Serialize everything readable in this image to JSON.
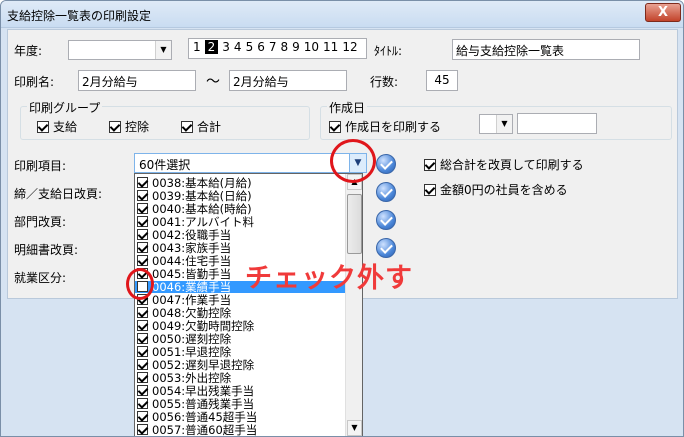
{
  "window": {
    "title": "支給控除一覧表の印刷設定",
    "close_glyph": "X"
  },
  "form": {
    "year_label": "年度:",
    "year_value": "",
    "month_numbers": [
      "1",
      "2",
      "3",
      "4",
      "5",
      "6",
      "7",
      "8",
      "9",
      "10",
      "11",
      "12"
    ],
    "month_selected": "2",
    "title_label": "ﾀｲﾄﾙ:",
    "title_value": "給与支給控除一覧表",
    "print_name_label": "印刷名:",
    "print_name_from": "2月分給与",
    "print_name_sep": "～",
    "print_name_to": "2月分給与",
    "rows_label": "行数:",
    "rows_value": "45",
    "print_group": {
      "title": "印刷グループ",
      "items": [
        {
          "label": "支給",
          "checked": true
        },
        {
          "label": "控除",
          "checked": true
        },
        {
          "label": "合計",
          "checked": true
        }
      ]
    },
    "created_date": {
      "title": "作成日",
      "print_label": "作成日を印刷する",
      "print_checked": true,
      "date_value": ""
    },
    "print_items_label": "印刷項目:",
    "print_items_value": "60件選択",
    "shime_label": "締／支給日改頁:",
    "dept_label": "部門改頁:",
    "detail_label": "明細書改頁:",
    "work_label": "就業区分:",
    "options": [
      {
        "label": "総合計を改頁して印刷する",
        "checked": true
      },
      {
        "label": "金額0円の社員を含める",
        "checked": true
      }
    ]
  },
  "list_items": [
    {
      "label": "0038:基本給(月給)",
      "checked": true,
      "selected": false
    },
    {
      "label": "0039:基本給(日給)",
      "checked": true,
      "selected": false
    },
    {
      "label": "0040:基本給(時給)",
      "checked": true,
      "selected": false
    },
    {
      "label": "0041:アルバイト料",
      "checked": true,
      "selected": false
    },
    {
      "label": "0042:役職手当",
      "checked": true,
      "selected": false
    },
    {
      "label": "0043:家族手当",
      "checked": true,
      "selected": false
    },
    {
      "label": "0044:住宅手当",
      "checked": true,
      "selected": false
    },
    {
      "label": "0045:皆勤手当",
      "checked": true,
      "selected": false
    },
    {
      "label": "0046:業績手当",
      "checked": false,
      "selected": true
    },
    {
      "label": "0047:作業手当",
      "checked": true,
      "selected": false
    },
    {
      "label": "0048:欠勤控除",
      "checked": true,
      "selected": false
    },
    {
      "label": "0049:欠勤時間控除",
      "checked": true,
      "selected": false
    },
    {
      "label": "0050:遅刻控除",
      "checked": true,
      "selected": false
    },
    {
      "label": "0051:早退控除",
      "checked": true,
      "selected": false
    },
    {
      "label": "0052:遅刻早退控除",
      "checked": true,
      "selected": false
    },
    {
      "label": "0053:外出控除",
      "checked": true,
      "selected": false
    },
    {
      "label": "0054:早出残業手当",
      "checked": true,
      "selected": false
    },
    {
      "label": "0055:普通残業手当",
      "checked": true,
      "selected": false
    },
    {
      "label": "0056:普通45超手当",
      "checked": true,
      "selected": false
    },
    {
      "label": "0057:普通60超手当",
      "checked": true,
      "selected": false
    }
  ],
  "annotation": {
    "text": "チェック外す",
    "color": "#f03a3a"
  },
  "colors": {
    "highlight": "#3399ff",
    "annotation_ring": "#e0161b"
  }
}
